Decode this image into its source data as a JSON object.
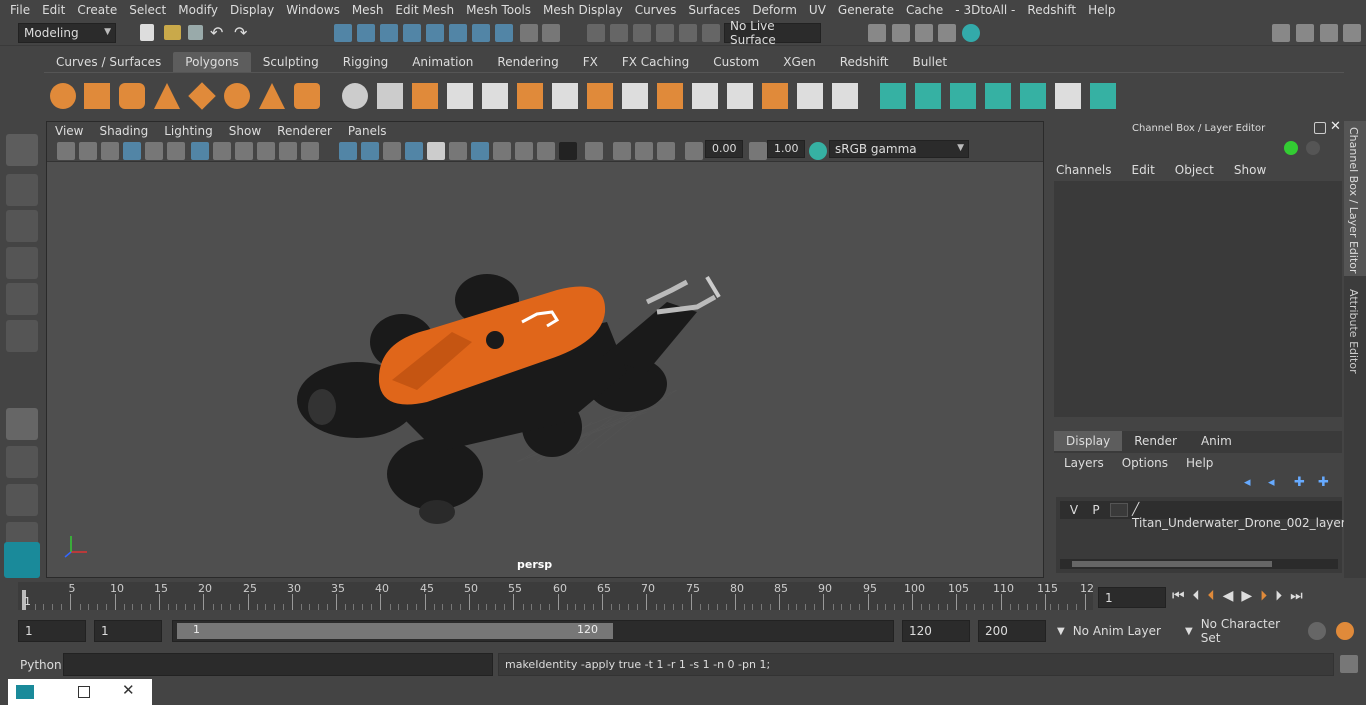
{
  "menubar": [
    "File",
    "Edit",
    "Create",
    "Select",
    "Modify",
    "Display",
    "Windows",
    "Mesh",
    "Edit Mesh",
    "Mesh Tools",
    "Mesh Display",
    "Curves",
    "Surfaces",
    "Deform",
    "UV",
    "Generate",
    "Cache",
    "- 3DtoAll -",
    "Redshift",
    "Help"
  ],
  "status": {
    "mode": "Modeling",
    "live_surface": "No Live Surface"
  },
  "shelf_tabs": [
    "Curves / Surfaces",
    "Polygons",
    "Sculpting",
    "Rigging",
    "Animation",
    "Rendering",
    "FX",
    "FX Caching",
    "Custom",
    "XGen",
    "Redshift",
    "Bullet"
  ],
  "shelf_active": "Polygons",
  "viewport": {
    "menu": [
      "View",
      "Shading",
      "Lighting",
      "Show",
      "Renderer",
      "Panels"
    ],
    "exposure": "0.00",
    "gamma": "1.00",
    "color_space": "sRGB gamma",
    "camera": "persp"
  },
  "channel_box": {
    "title": "Channel Box / Layer Editor",
    "menu": [
      "Channels",
      "Edit",
      "Object",
      "Show"
    ]
  },
  "layer_editor": {
    "tabs": [
      "Display",
      "Render",
      "Anim"
    ],
    "active_tab": "Display",
    "menu": [
      "Layers",
      "Options",
      "Help"
    ],
    "layer": {
      "v": "V",
      "p": "P",
      "name": "Titan_Underwater_Drone_002_layer"
    }
  },
  "side_tabs": [
    "Channel Box / Layer Editor",
    "Attribute Editor"
  ],
  "timeline": {
    "ticks": [
      "5",
      "10",
      "15",
      "20",
      "25",
      "30",
      "35",
      "40",
      "45",
      "50",
      "55",
      "60",
      "65",
      "70",
      "75",
      "80",
      "85",
      "90",
      "95",
      "100",
      "105",
      "110",
      "115",
      "12"
    ],
    "start": "1",
    "current": "1"
  },
  "range": {
    "start": "1",
    "playback_start": "1",
    "slider_start": "1",
    "slider_end": "120",
    "playback_end": "120",
    "end": "200",
    "anim_layer": "No Anim Layer",
    "char_set": "No Character Set"
  },
  "cmdline": {
    "label": "Python",
    "output": "makeIdentity -apply true -t 1 -r 1 -s 1 -n 0 -pn 1;"
  },
  "colors": {
    "accent": "#5285a6",
    "orange": "#e0661a",
    "teal": "#36b1a3"
  }
}
